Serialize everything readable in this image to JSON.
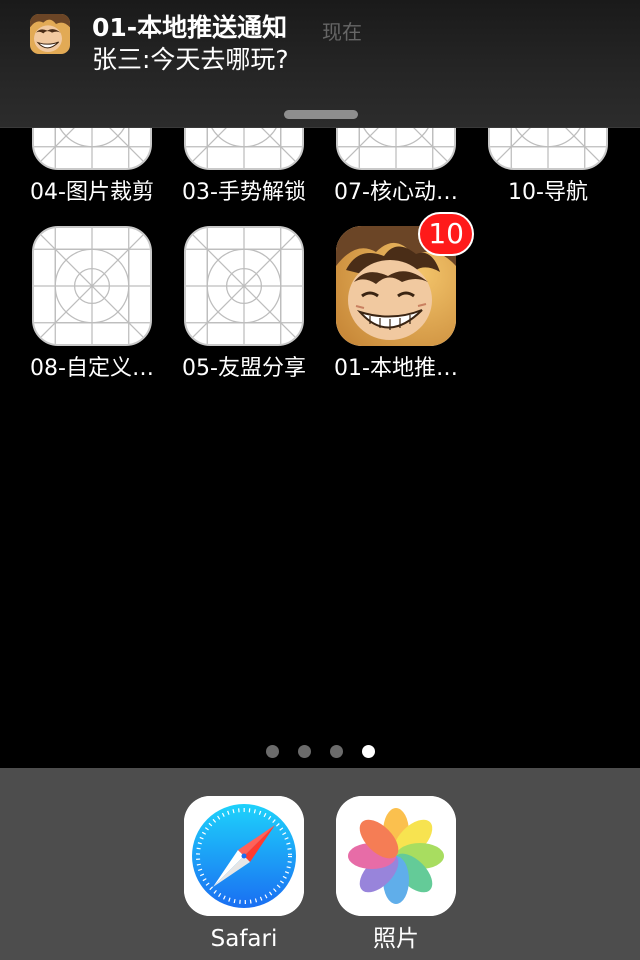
{
  "notification": {
    "app_name": "01-本地推送通知",
    "time": "现在",
    "message": "张三:今天去哪玩?",
    "avatar_icon": "luffy-avatar-icon"
  },
  "home": {
    "rows": [
      [
        {
          "label": "04-图片裁剪",
          "icon": "placeholder-app-icon"
        },
        {
          "label": "03-手势解锁",
          "icon": "placeholder-app-icon"
        },
        {
          "label": "07-核心动…",
          "icon": "placeholder-app-icon"
        },
        {
          "label": "10-导航",
          "icon": "placeholder-app-icon"
        }
      ],
      [
        {
          "label": "08-自定义…",
          "icon": "placeholder-app-icon"
        },
        {
          "label": "05-友盟分享",
          "icon": "placeholder-app-icon"
        },
        {
          "label": "01-本地推…",
          "icon": "luffy-avatar-icon",
          "badge": "10"
        }
      ]
    ],
    "page_count": 4,
    "current_page": 4
  },
  "dock": [
    {
      "label": "Safari",
      "icon": "safari-compass-icon"
    },
    {
      "label": "照片",
      "icon": "photos-flower-icon"
    }
  ],
  "colors": {
    "badge": "#ff1a1a",
    "dock_bg": "#4d4d4d",
    "background": "#000000"
  }
}
